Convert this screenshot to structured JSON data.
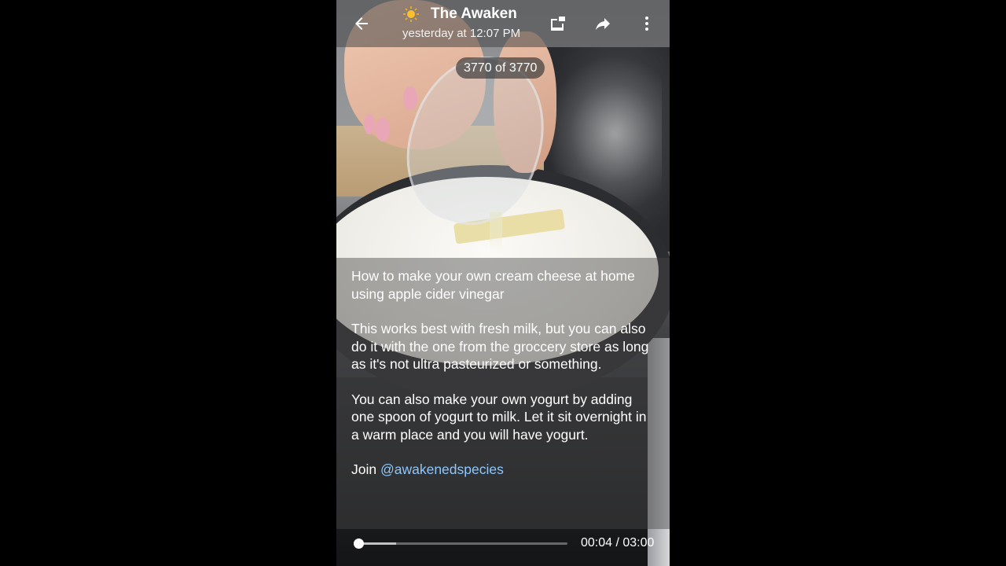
{
  "header": {
    "back_icon": "arrow-left-icon",
    "channel_icon": "sun-icon",
    "channel_title": "The Awaken",
    "subtitle": "yesterday at 12:07 PM",
    "actions": [
      {
        "name": "picture-in-picture-icon"
      },
      {
        "name": "share-icon"
      },
      {
        "name": "more-vertical-icon"
      }
    ]
  },
  "media": {
    "counter": "3770 of 3770"
  },
  "caption": {
    "paragraphs": [
      "How to make your own cream cheese at home using apple cider vinegar",
      "This works best with fresh milk, but you can also do it with the one from the groccery store as long as it's not ultra pasteurized or something.",
      "You can also make your own yogurt by adding one spoon of yogurt to milk. Let it sit overnight in a warm place and you will have yogurt."
    ],
    "join_prefix": "Join ",
    "join_link": "@awakenedspecies"
  },
  "player": {
    "current_time": "00:04",
    "total_time": "03:00",
    "time_display": "00:04 / 03:00",
    "progress_fraction": 0.022
  },
  "colors": {
    "link": "#8cc8ff",
    "nail": "#e8a6b6"
  }
}
